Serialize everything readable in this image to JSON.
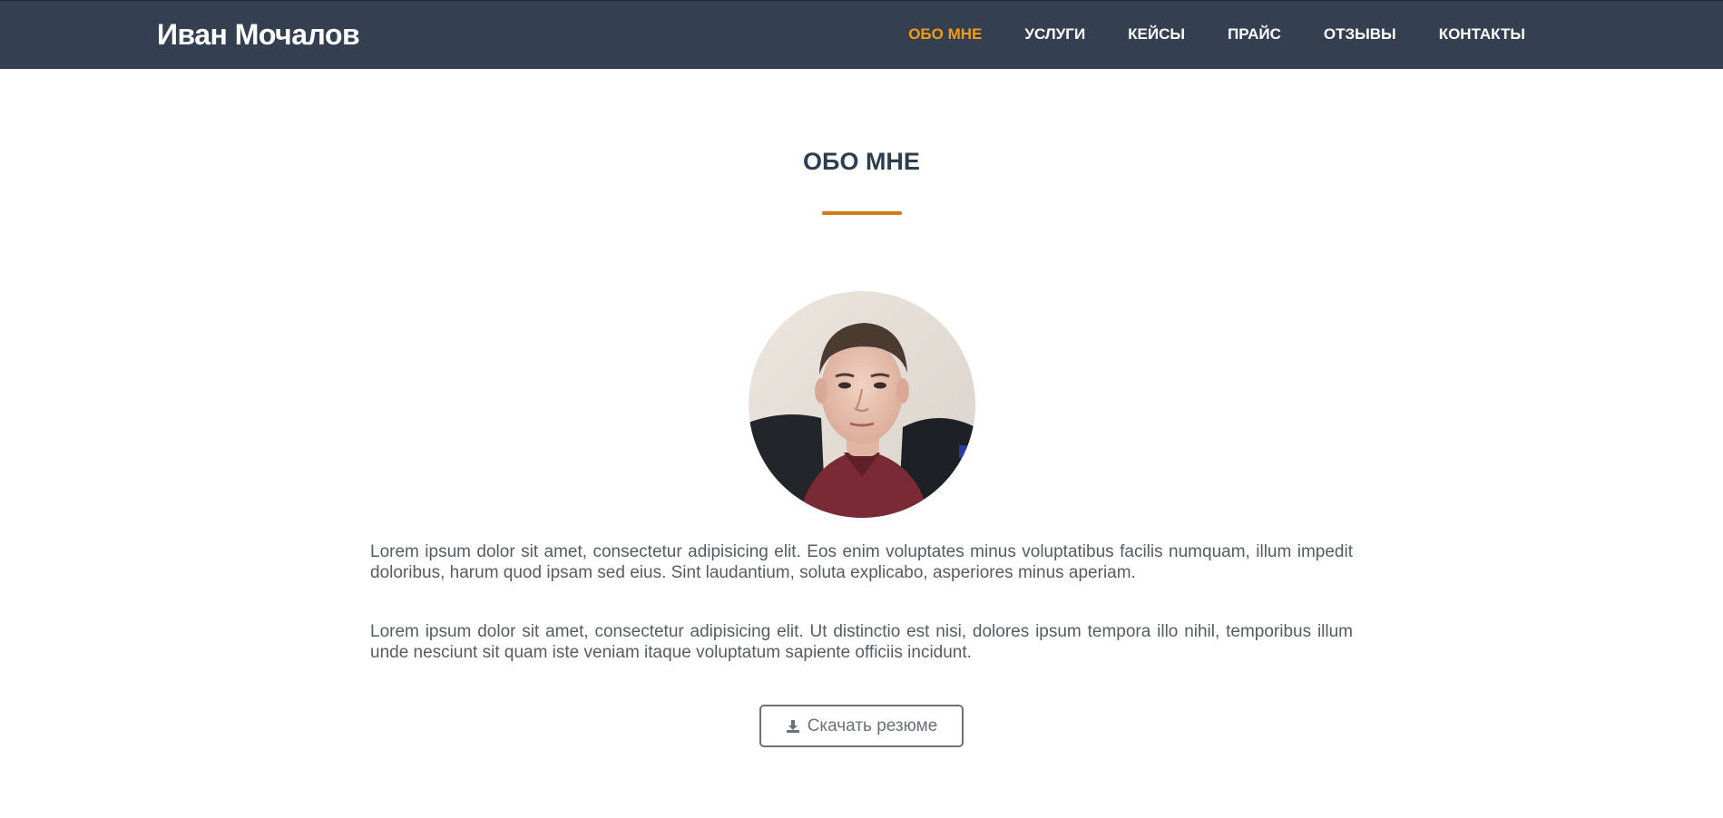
{
  "header": {
    "brand": "Иван Мочалов",
    "nav": [
      {
        "label": "ОБО МНЕ",
        "active": true
      },
      {
        "label": "УСЛУГИ",
        "active": false
      },
      {
        "label": "КЕЙСЫ",
        "active": false
      },
      {
        "label": "ПРАЙС",
        "active": false
      },
      {
        "label": "ОТЗЫВЫ",
        "active": false
      },
      {
        "label": "КОНТАКТЫ",
        "active": false
      }
    ]
  },
  "about": {
    "title": "ОБО МНЕ",
    "paragraphs": [
      "Lorem ipsum dolor sit amet, consectetur adipisicing elit. Eos enim voluptates minus voluptatibus facilis numquam, illum impedit doloribus, harum quod ipsam sed eius. Sint laudantium, soluta explicabo, asperiores minus aperiam.",
      "Lorem ipsum dolor sit amet, consectetur adipisicing elit. Ut distinctio est nisi, dolores ipsum tempora illo nihil, temporibus illum unde nesciunt sit quam iste veniam itaque voluptatum sapiente officiis incidunt."
    ],
    "download_button": {
      "label": "Скачать резюме",
      "icon": "download-icon"
    }
  },
  "colors": {
    "navbar": "#343f51",
    "accent": "#f39c12",
    "underline": "#d4781a",
    "title": "#2c3e50",
    "body_text": "#555c63"
  }
}
